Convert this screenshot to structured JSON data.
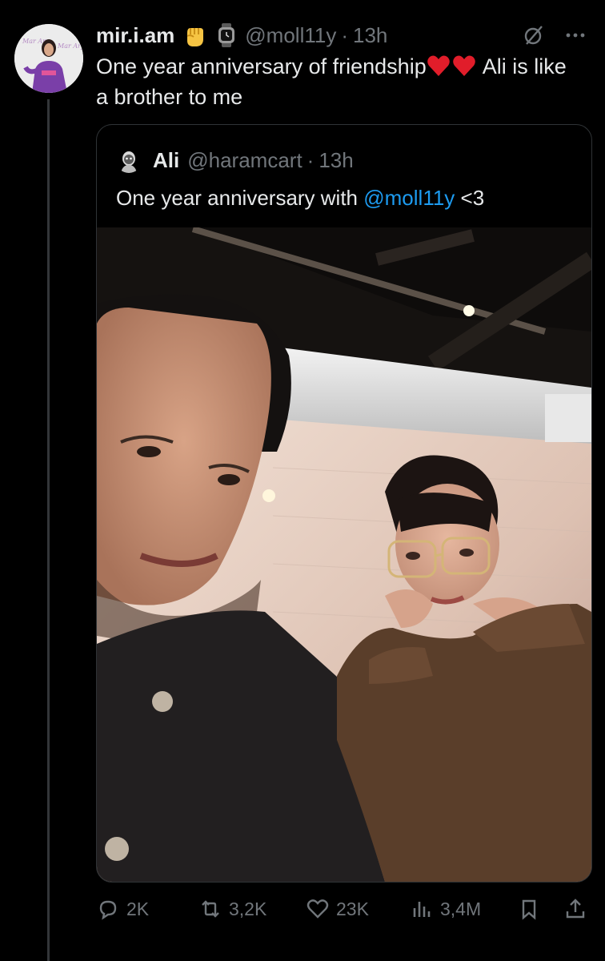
{
  "tweet": {
    "display_name": "mir.i.am",
    "handle": "@moll11y",
    "separator": "·",
    "time": "13h",
    "text_part1": "One year anniversary of friendship",
    "text_part2": " Ali is like a brother to me",
    "badges": [
      "raised-fist-icon",
      "watch-icon"
    ],
    "text_emoji": [
      "red-heart-icon",
      "red-heart-icon"
    ]
  },
  "quote": {
    "display_name": "Ali",
    "handle": "@haramcart",
    "separator": "·",
    "time": "13h",
    "text_prefix": "One year anniversary with ",
    "mention": "@moll11y",
    "text_suffix": " <3"
  },
  "actions": {
    "replies": "2K",
    "reposts": "3,2K",
    "likes": "23K",
    "views": "3,4M"
  },
  "colors": {
    "background": "#000000",
    "text": "#e7e9ea",
    "muted": "#71767b",
    "link": "#1d9bf0",
    "border": "#2f3336"
  }
}
